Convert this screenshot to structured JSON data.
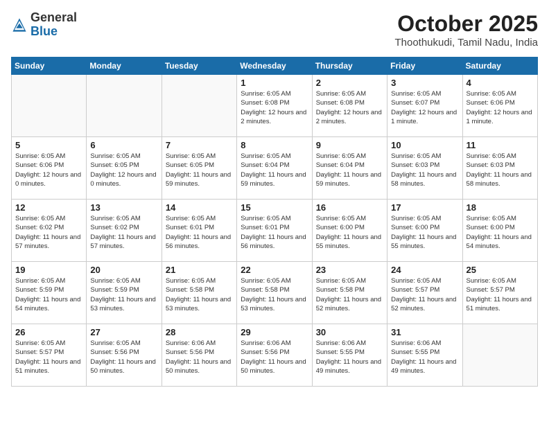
{
  "logo": {
    "general": "General",
    "blue": "Blue"
  },
  "title": "October 2025",
  "location": "Thoothukudi, Tamil Nadu, India",
  "days_of_week": [
    "Sunday",
    "Monday",
    "Tuesday",
    "Wednesday",
    "Thursday",
    "Friday",
    "Saturday"
  ],
  "weeks": [
    [
      {
        "day": "",
        "info": ""
      },
      {
        "day": "",
        "info": ""
      },
      {
        "day": "",
        "info": ""
      },
      {
        "day": "1",
        "info": "Sunrise: 6:05 AM\nSunset: 6:08 PM\nDaylight: 12 hours and 2 minutes."
      },
      {
        "day": "2",
        "info": "Sunrise: 6:05 AM\nSunset: 6:08 PM\nDaylight: 12 hours and 2 minutes."
      },
      {
        "day": "3",
        "info": "Sunrise: 6:05 AM\nSunset: 6:07 PM\nDaylight: 12 hours and 1 minute."
      },
      {
        "day": "4",
        "info": "Sunrise: 6:05 AM\nSunset: 6:06 PM\nDaylight: 12 hours and 1 minute."
      }
    ],
    [
      {
        "day": "5",
        "info": "Sunrise: 6:05 AM\nSunset: 6:06 PM\nDaylight: 12 hours and 0 minutes."
      },
      {
        "day": "6",
        "info": "Sunrise: 6:05 AM\nSunset: 6:05 PM\nDaylight: 12 hours and 0 minutes."
      },
      {
        "day": "7",
        "info": "Sunrise: 6:05 AM\nSunset: 6:05 PM\nDaylight: 11 hours and 59 minutes."
      },
      {
        "day": "8",
        "info": "Sunrise: 6:05 AM\nSunset: 6:04 PM\nDaylight: 11 hours and 59 minutes."
      },
      {
        "day": "9",
        "info": "Sunrise: 6:05 AM\nSunset: 6:04 PM\nDaylight: 11 hours and 59 minutes."
      },
      {
        "day": "10",
        "info": "Sunrise: 6:05 AM\nSunset: 6:03 PM\nDaylight: 11 hours and 58 minutes."
      },
      {
        "day": "11",
        "info": "Sunrise: 6:05 AM\nSunset: 6:03 PM\nDaylight: 11 hours and 58 minutes."
      }
    ],
    [
      {
        "day": "12",
        "info": "Sunrise: 6:05 AM\nSunset: 6:02 PM\nDaylight: 11 hours and 57 minutes."
      },
      {
        "day": "13",
        "info": "Sunrise: 6:05 AM\nSunset: 6:02 PM\nDaylight: 11 hours and 57 minutes."
      },
      {
        "day": "14",
        "info": "Sunrise: 6:05 AM\nSunset: 6:01 PM\nDaylight: 11 hours and 56 minutes."
      },
      {
        "day": "15",
        "info": "Sunrise: 6:05 AM\nSunset: 6:01 PM\nDaylight: 11 hours and 56 minutes."
      },
      {
        "day": "16",
        "info": "Sunrise: 6:05 AM\nSunset: 6:00 PM\nDaylight: 11 hours and 55 minutes."
      },
      {
        "day": "17",
        "info": "Sunrise: 6:05 AM\nSunset: 6:00 PM\nDaylight: 11 hours and 55 minutes."
      },
      {
        "day": "18",
        "info": "Sunrise: 6:05 AM\nSunset: 6:00 PM\nDaylight: 11 hours and 54 minutes."
      }
    ],
    [
      {
        "day": "19",
        "info": "Sunrise: 6:05 AM\nSunset: 5:59 PM\nDaylight: 11 hours and 54 minutes."
      },
      {
        "day": "20",
        "info": "Sunrise: 6:05 AM\nSunset: 5:59 PM\nDaylight: 11 hours and 53 minutes."
      },
      {
        "day": "21",
        "info": "Sunrise: 6:05 AM\nSunset: 5:58 PM\nDaylight: 11 hours and 53 minutes."
      },
      {
        "day": "22",
        "info": "Sunrise: 6:05 AM\nSunset: 5:58 PM\nDaylight: 11 hours and 53 minutes."
      },
      {
        "day": "23",
        "info": "Sunrise: 6:05 AM\nSunset: 5:58 PM\nDaylight: 11 hours and 52 minutes."
      },
      {
        "day": "24",
        "info": "Sunrise: 6:05 AM\nSunset: 5:57 PM\nDaylight: 11 hours and 52 minutes."
      },
      {
        "day": "25",
        "info": "Sunrise: 6:05 AM\nSunset: 5:57 PM\nDaylight: 11 hours and 51 minutes."
      }
    ],
    [
      {
        "day": "26",
        "info": "Sunrise: 6:05 AM\nSunset: 5:57 PM\nDaylight: 11 hours and 51 minutes."
      },
      {
        "day": "27",
        "info": "Sunrise: 6:05 AM\nSunset: 5:56 PM\nDaylight: 11 hours and 50 minutes."
      },
      {
        "day": "28",
        "info": "Sunrise: 6:06 AM\nSunset: 5:56 PM\nDaylight: 11 hours and 50 minutes."
      },
      {
        "day": "29",
        "info": "Sunrise: 6:06 AM\nSunset: 5:56 PM\nDaylight: 11 hours and 50 minutes."
      },
      {
        "day": "30",
        "info": "Sunrise: 6:06 AM\nSunset: 5:55 PM\nDaylight: 11 hours and 49 minutes."
      },
      {
        "day": "31",
        "info": "Sunrise: 6:06 AM\nSunset: 5:55 PM\nDaylight: 11 hours and 49 minutes."
      },
      {
        "day": "",
        "info": ""
      }
    ]
  ]
}
